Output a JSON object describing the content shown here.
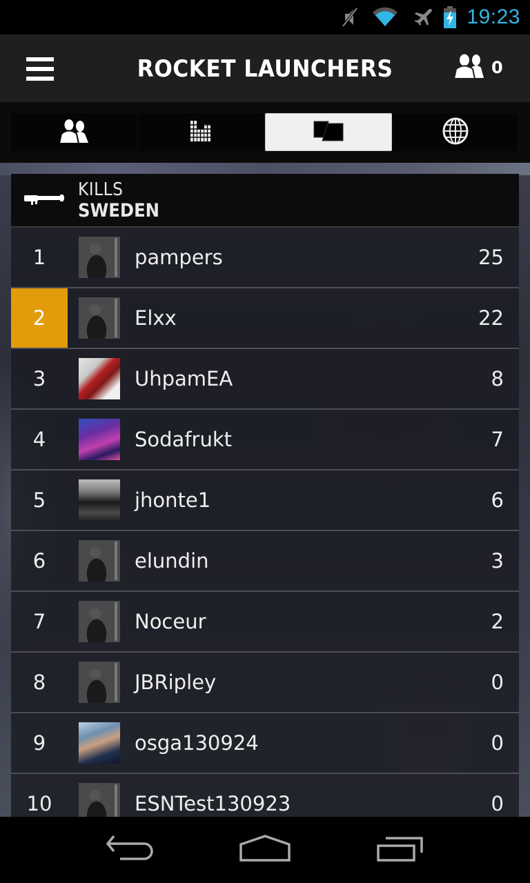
{
  "status_bar": {
    "icons": [
      "mute-icon",
      "wifi-icon",
      "airplane-mode-icon",
      "battery-charging-icon"
    ],
    "time": "19:23",
    "time_color": "#33b5e5"
  },
  "header": {
    "menu_icon": "hamburger-menu-icon",
    "title": "ROCKET LAUNCHERS",
    "friends_icon": "friends-icon",
    "friends_count": "0"
  },
  "tabs": [
    {
      "icon": "friends-icon",
      "active": false
    },
    {
      "icon": "bar-chart-icon",
      "active": false
    },
    {
      "icon": "cards-icon",
      "active": true
    },
    {
      "icon": "globe-icon",
      "active": false
    }
  ],
  "leaderboard": {
    "weapon_icon": "rocket-launcher-icon",
    "stat": "KILLS",
    "region": "SWEDEN",
    "highlight_color": "#e29b0a",
    "rows": [
      {
        "rank": "1",
        "name": "pampers",
        "score": "25",
        "avatar": "default-soldier",
        "highlight": false
      },
      {
        "rank": "2",
        "name": "Elxx",
        "score": "22",
        "avatar": "default-soldier",
        "highlight": true
      },
      {
        "rank": "3",
        "name": "UhpamEA",
        "score": "8",
        "avatar": "photo",
        "highlight": false
      },
      {
        "rank": "4",
        "name": "Sodafrukt",
        "score": "7",
        "avatar": "photo",
        "highlight": false
      },
      {
        "rank": "5",
        "name": "jhonte1",
        "score": "6",
        "avatar": "photo",
        "highlight": false
      },
      {
        "rank": "6",
        "name": "elundin",
        "score": "3",
        "avatar": "default-soldier",
        "highlight": false
      },
      {
        "rank": "7",
        "name": "Noceur",
        "score": "2",
        "avatar": "default-soldier",
        "highlight": false
      },
      {
        "rank": "8",
        "name": "JBRipley",
        "score": "0",
        "avatar": "default-soldier",
        "highlight": false
      },
      {
        "rank": "9",
        "name": "osga130924",
        "score": "0",
        "avatar": "photo",
        "highlight": false
      },
      {
        "rank": "10",
        "name": "ESNTest130923",
        "score": "0",
        "avatar": "default-soldier",
        "highlight": false
      }
    ]
  },
  "nav_bar": {
    "buttons": [
      "back-icon",
      "home-icon",
      "recent-apps-icon"
    ]
  }
}
